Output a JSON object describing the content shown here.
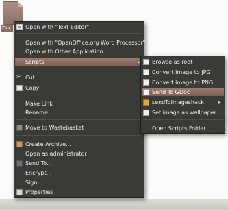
{
  "desktop": {
    "file": {
      "label": "Doc"
    }
  },
  "context_menu": {
    "items": [
      {
        "label": "Open with \"Text Editor\"",
        "icon": "text-editor-icon"
      },
      {
        "label": "Open with \"OpenOffice.org Word Processor\""
      },
      {
        "label": "Open with Other Application..."
      },
      {
        "label": "Scripts",
        "submenu": true,
        "arrow": "▸"
      },
      {
        "label": "Cut",
        "icon": "scissors-icon"
      },
      {
        "label": "Copy",
        "icon": "copy-icon"
      },
      {
        "label": "Make Link"
      },
      {
        "label": "Rename..."
      },
      {
        "label": "Move to Wastebasket",
        "icon": "trash-icon"
      },
      {
        "label": "Create Archive...",
        "icon": "archive-icon"
      },
      {
        "label": "Open as administrator"
      },
      {
        "label": "Send To...",
        "icon": "send-to-icon"
      },
      {
        "label": "Encrypt..."
      },
      {
        "label": "Sign"
      },
      {
        "label": "Properties",
        "icon": "properties-icon"
      }
    ],
    "active_item": "Scripts"
  },
  "scripts_submenu": {
    "items": [
      {
        "label": "Browse as root",
        "icon": "script-icon"
      },
      {
        "label": "Convert image to JPG",
        "icon": "script-icon"
      },
      {
        "label": "Convert image to PNG",
        "icon": "script-icon"
      },
      {
        "label": "Send To GDoc",
        "icon": "gdoc-icon"
      },
      {
        "label": "sendToImageshack",
        "icon": "folder-icon",
        "arrow": "▸"
      },
      {
        "label": "Set image as wallpaper",
        "icon": "script-icon"
      },
      {
        "label": "Open Scripts Folder"
      }
    ],
    "active_item": "Send To GDoc"
  },
  "colors": {
    "menu_bg": "#3a3a37",
    "highlight": "#8a6b5e",
    "desktop_bg": "#fbfbfa"
  }
}
